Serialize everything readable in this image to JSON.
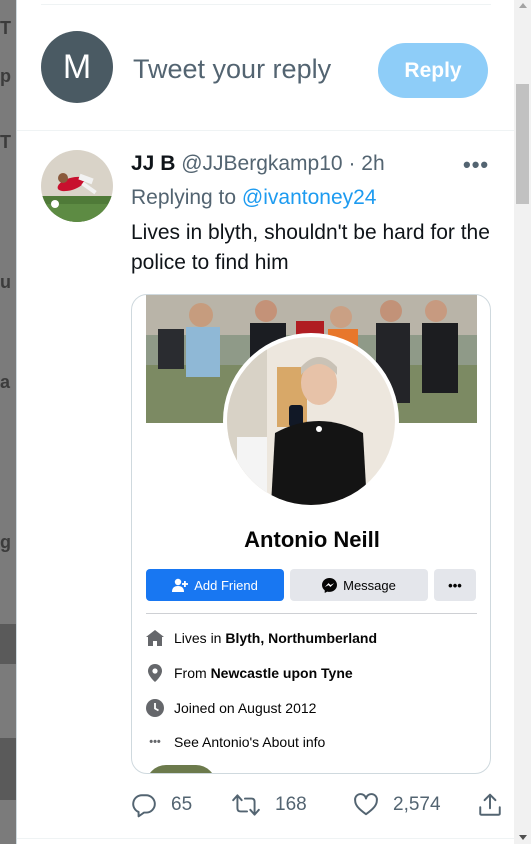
{
  "compose": {
    "avatar_letter": "M",
    "placeholder": "Tweet your reply",
    "reply_label": "Reply"
  },
  "tweet": {
    "name": "JJ B",
    "handle": "@JJBergkamp10",
    "separator": "·",
    "time": "2h",
    "more": "•••",
    "replying_prefix": "Replying to",
    "replying_to": "@ivantoney24",
    "text": "Lives in blyth, shouldn't be hard for the police to find him",
    "stats": {
      "replies": "65",
      "retweets": "168",
      "likes": "2,574"
    }
  },
  "fb_card": {
    "name": "Antonio Neill",
    "add_friend": "Add Friend",
    "message": "Message",
    "more": "•••",
    "lives_prefix": "Lives in",
    "lives_place": "Blyth, Northumberland",
    "from_prefix": "From",
    "from_place": "Newcastle upon Tyne",
    "joined": "Joined on August 2012",
    "about": "See Antonio's About info"
  },
  "colors": {
    "twitter_blue": "#1d9bf0",
    "reply_button": "#8ecdf8",
    "facebook_blue": "#1877f2",
    "muted_text": "#536471"
  }
}
